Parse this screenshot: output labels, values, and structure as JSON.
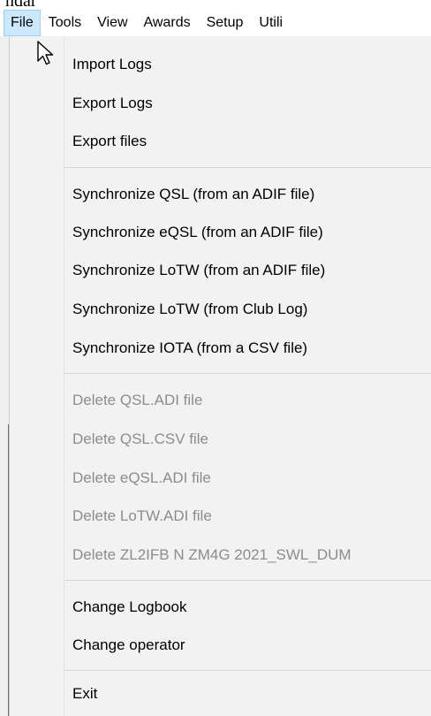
{
  "window": {
    "title_fragment": "ndar"
  },
  "menubar": {
    "items": [
      {
        "label": "File",
        "active": true
      },
      {
        "label": "Tools"
      },
      {
        "label": "View"
      },
      {
        "label": "Awards"
      },
      {
        "label": "Setup"
      },
      {
        "label": "Utili"
      }
    ]
  },
  "file_menu": {
    "items": [
      {
        "label": "Import Logs",
        "enabled": true
      },
      {
        "label": "Export Logs",
        "enabled": true
      },
      {
        "label": "Export files",
        "enabled": true
      },
      {
        "label": "Synchronize QSL (from an ADIF file)",
        "enabled": true
      },
      {
        "label": "Synchronize eQSL (from an ADIF file)",
        "enabled": true
      },
      {
        "label": "Synchronize LoTW (from an ADIF file)",
        "enabled": true
      },
      {
        "label": "Synchronize LoTW (from Club Log)",
        "enabled": true
      },
      {
        "label": "Synchronize IOTA (from a CSV file)",
        "enabled": true
      },
      {
        "label": "Delete QSL.ADI file",
        "enabled": false
      },
      {
        "label": "Delete QSL.CSV file",
        "enabled": false
      },
      {
        "label": "Delete eQSL.ADI file",
        "enabled": false
      },
      {
        "label": "Delete LoTW.ADI file",
        "enabled": false
      },
      {
        "label": "Delete ZL2IFB N ZM4G 2021_SWL_DUM",
        "enabled": false
      },
      {
        "label": "Change Logbook",
        "enabled": true
      },
      {
        "label": "Change operator",
        "enabled": true
      },
      {
        "label": "Exit",
        "enabled": true
      }
    ]
  },
  "colors": {
    "menu_background": "#f2f2f2",
    "active_menubar_background": "#cce8ff",
    "active_menubar_border": "#99d1ff",
    "disabled_text": "#8c8c8c"
  }
}
